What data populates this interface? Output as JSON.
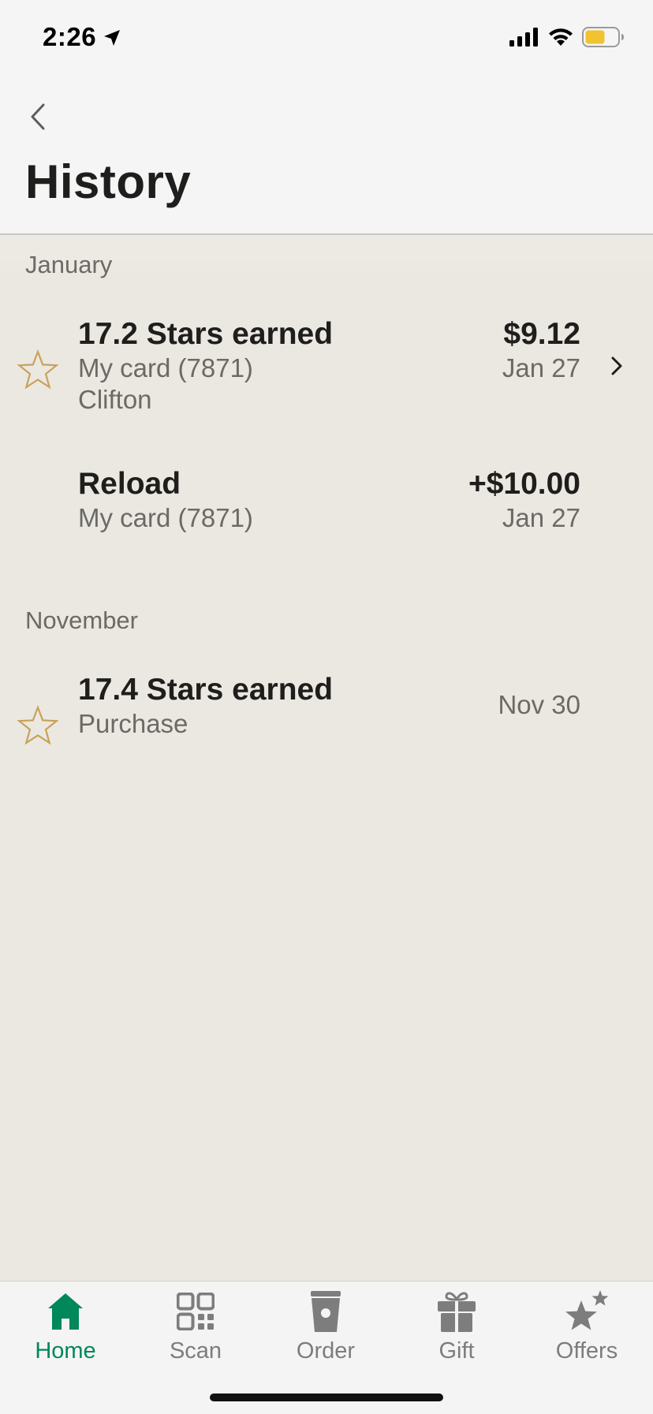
{
  "status_bar": {
    "time": "2:26",
    "icons": [
      "location-arrow-icon",
      "signal-icon",
      "wifi-icon",
      "battery-icon"
    ],
    "battery_color": "#f0c330"
  },
  "header": {
    "back_icon": "chevron-left-icon",
    "title": "History"
  },
  "sections": [
    {
      "month": "January",
      "transactions": [
        {
          "icon": "star-outline-icon",
          "title": "17.2 Stars earned",
          "lines": [
            "My card (7871)",
            "Clifton"
          ],
          "amount": "$9.12",
          "date": "Jan 27",
          "has_chevron": true
        },
        {
          "icon": "",
          "title": "Reload",
          "lines": [
            "My card (7871)"
          ],
          "amount": "+$10.00",
          "date": "Jan 27",
          "has_chevron": false
        }
      ]
    },
    {
      "month": "November",
      "transactions": [
        {
          "icon": "star-outline-icon",
          "title": "17.4 Stars earned",
          "lines": [
            "Purchase"
          ],
          "amount": "",
          "date": "Nov 30",
          "has_chevron": false
        }
      ]
    }
  ],
  "tab_bar": {
    "active": "Home",
    "accent_color": "#00875a",
    "inactive_color": "#7d7d7d",
    "tabs": [
      {
        "label": "Home",
        "icon": "home-icon"
      },
      {
        "label": "Scan",
        "icon": "qr-code-icon"
      },
      {
        "label": "Order",
        "icon": "cup-icon"
      },
      {
        "label": "Gift",
        "icon": "gift-icon"
      },
      {
        "label": "Offers",
        "icon": "stars-icon"
      }
    ]
  },
  "colors": {
    "star": "#c9a25a",
    "background": "#ebe8e1",
    "header_background": "#f5f5f5"
  }
}
